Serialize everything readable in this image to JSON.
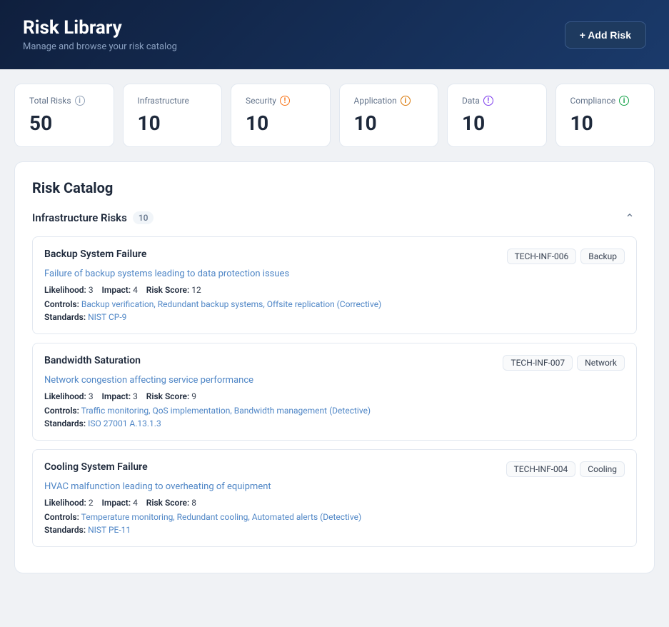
{
  "header": {
    "title": "Risk Library",
    "subtitle": "Manage and browse your risk catalog",
    "add_button_label": "+ Add Risk"
  },
  "stats": [
    {
      "id": "total",
      "label": "Total Risks",
      "value": "50",
      "icon_type": "gray",
      "icon_char": "i"
    },
    {
      "id": "infrastructure",
      "label": "Infrastructure",
      "value": "10",
      "icon_type": null,
      "icon_char": null
    },
    {
      "id": "security",
      "label": "Security",
      "value": "10",
      "icon_type": "orange",
      "icon_char": "!"
    },
    {
      "id": "application",
      "label": "Application",
      "value": "10",
      "icon_type": "amber",
      "icon_char": "i"
    },
    {
      "id": "data",
      "label": "Data",
      "value": "10",
      "icon_type": "purple",
      "icon_char": "!"
    },
    {
      "id": "compliance",
      "label": "Compliance",
      "value": "10",
      "icon_type": "green",
      "icon_char": "i"
    }
  ],
  "catalog": {
    "title": "Risk Catalog",
    "sections": [
      {
        "id": "infrastructure",
        "title": "Infrastructure Risks",
        "count": "10",
        "risks": [
          {
            "id": "risk-1",
            "title": "Backup System Failure",
            "code": "TECH-INF-006",
            "tag": "Backup",
            "description": "Failure of backup systems leading to data protection issues",
            "likelihood": "3",
            "impact": "4",
            "risk_score": "12",
            "controls": "Backup verification, Redundant backup systems, Offsite replication (Corrective)",
            "standards": "NIST CP-9"
          },
          {
            "id": "risk-2",
            "title": "Bandwidth Saturation",
            "code": "TECH-INF-007",
            "tag": "Network",
            "description": "Network congestion affecting service performance",
            "likelihood": "3",
            "impact": "3",
            "risk_score": "9",
            "controls": "Traffic monitoring, QoS implementation, Bandwidth management (Detective)",
            "standards": "ISO 27001 A.13.1.3"
          },
          {
            "id": "risk-3",
            "title": "Cooling System Failure",
            "code": "TECH-INF-004",
            "tag": "Cooling",
            "description": "HVAC malfunction leading to overheating of equipment",
            "likelihood": "2",
            "impact": "4",
            "risk_score": "8",
            "controls": "Temperature monitoring, Redundant cooling, Automated alerts (Detective)",
            "standards": "NIST PE-11"
          }
        ]
      }
    ]
  },
  "labels": {
    "likelihood": "Likelihood:",
    "impact": "Impact:",
    "risk_score": "Risk Score:",
    "controls": "Controls:",
    "standards": "Standards:"
  }
}
